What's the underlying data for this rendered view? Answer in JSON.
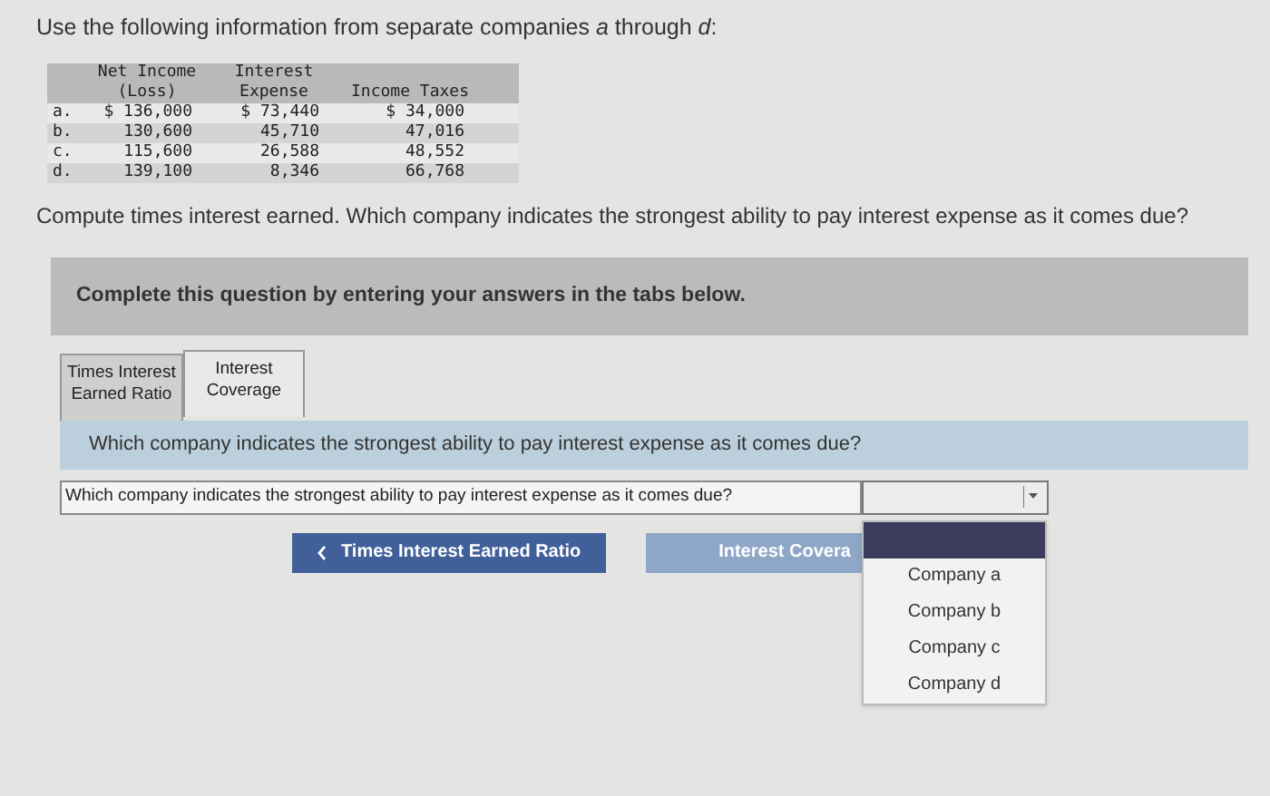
{
  "intro": "Use the following information from separate companies *a* through *d*:",
  "table": {
    "columns": [
      "Net Income (Loss)",
      "Interest Expense",
      "Income Taxes"
    ],
    "rows": [
      {
        "label": "a.",
        "cells": [
          "$ 136,000",
          "$ 73,440",
          "$ 34,000"
        ]
      },
      {
        "label": "b.",
        "cells": [
          "130,600",
          "45,710",
          "47,016"
        ]
      },
      {
        "label": "c.",
        "cells": [
          "115,600",
          "26,588",
          "48,552"
        ]
      },
      {
        "label": "d.",
        "cells": [
          "139,100",
          "8,346",
          "66,768"
        ]
      }
    ]
  },
  "question": "Compute times interest earned. Which company indicates the strongest ability to pay interest expense as it comes due?",
  "banner": "Complete this question by entering your answers in the tabs below.",
  "tabs": [
    {
      "lines": [
        "Times Interest",
        "Earned Ratio"
      ],
      "selected": false
    },
    {
      "lines": [
        "Interest",
        "Coverage"
      ],
      "selected": true
    }
  ],
  "prompt": "Which company indicates the strongest ability to pay interest expense as it comes due?",
  "answer_row": {
    "label": "Which company indicates the strongest ability to pay interest expense as it comes due?",
    "dropdown": {
      "expanded": true,
      "blank_highlighted": true,
      "options": [
        {
          "label": "Company a",
          "selected": false
        },
        {
          "label": "Company b",
          "selected": false
        },
        {
          "label": "Company c",
          "selected": false
        },
        {
          "label": "Company d",
          "selected": false
        }
      ]
    }
  },
  "buttons": [
    {
      "kind": "prev",
      "label": "Times Interest Earned Ratio",
      "disabled": false
    },
    {
      "kind": "next",
      "label": "Interest Covera",
      "disabled": true
    }
  ]
}
